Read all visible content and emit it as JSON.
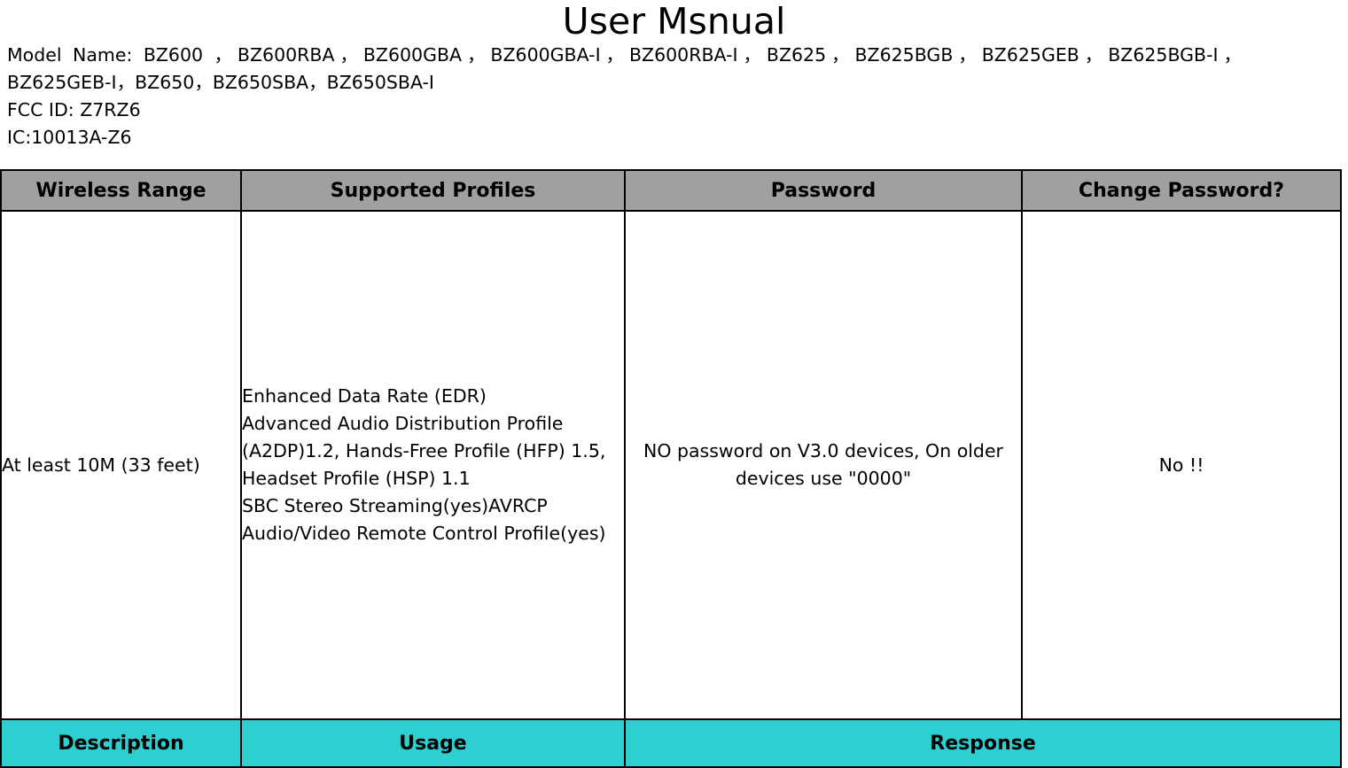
{
  "document": {
    "title": "User Msnual",
    "model_label": "Model Name: BZ600 ，BZ600RBA，BZ600GBA，BZ600GBA-I，BZ600RBA-I，BZ625，BZ625BGB，BZ625GEB，BZ625BGB-I，BZ625GEB-I，BZ650，BZ650SBA，BZ650SBA-I",
    "fcc_id": "FCC ID: Z7RZ6",
    "ic_id": "IC:10013A-Z6"
  },
  "table": {
    "headers": [
      "Wireless Range",
      "Supported Profiles",
      "Password",
      "Change Password?"
    ],
    "row": {
      "wireless_range": "At least 10M (33 feet)",
      "supported_profiles": "Enhanced Data Rate (EDR)\nAdvanced Audio Distribution Profile (A2DP)1.2, Hands-Free Profile (HFP) 1.5, Headset Profile (HSP) 1.1\nSBC Stereo Streaming(yes)AVRCP Audio/Video Remote Control Profile(yes)",
      "password": "NO password on V3.0 devices, On older devices use \"0000\"",
      "change_password": "No !!"
    },
    "footer": [
      "Description",
      "Usage",
      "Response"
    ]
  },
  "colors": {
    "header_background": "#a0a0a0",
    "footer_background": "#2ecfd1",
    "border": "#000000",
    "text": "#000000"
  }
}
